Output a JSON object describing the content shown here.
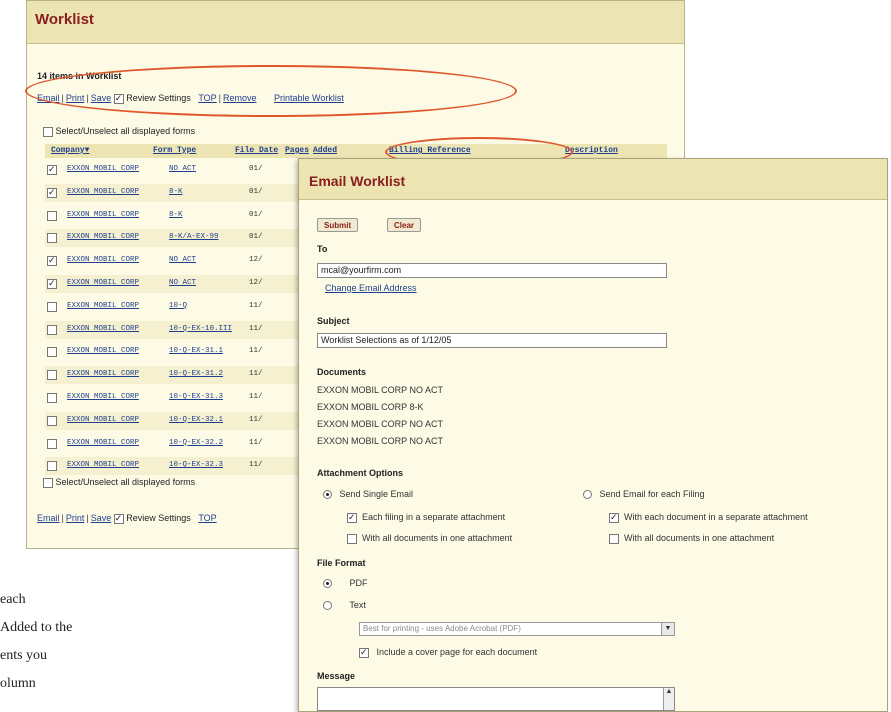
{
  "worklist": {
    "title": "Worklist",
    "count_text": "14 items in Worklist",
    "toolbar": {
      "email": "Email",
      "print": "Print",
      "save": "Save",
      "review_settings": "Review Settings",
      "top": "TOP",
      "remove": "Remove",
      "printable": "Printable Worklist"
    },
    "select_all": "Select/Unselect all displayed forms",
    "columns": [
      "Company",
      "Form Type",
      "File Date",
      "Pages",
      "Added",
      "Billing Reference",
      "Description"
    ],
    "rows": [
      {
        "company": "EXXON MOBIL CORP",
        "form": "NO ACT",
        "date": "01/",
        "checked": true
      },
      {
        "company": "EXXON MOBIL CORP",
        "form": "8-K",
        "date": "01/",
        "checked": true
      },
      {
        "company": "EXXON MOBIL CORP",
        "form": "8-K",
        "date": "01/",
        "checked": false
      },
      {
        "company": "EXXON MOBIL CORP",
        "form": "8-K/A-EX-99",
        "date": "01/",
        "checked": false
      },
      {
        "company": "EXXON MOBIL CORP",
        "form": "NO ACT",
        "date": "12/",
        "checked": true
      },
      {
        "company": "EXXON MOBIL CORP",
        "form": "NO ACT",
        "date": "12/",
        "checked": true
      },
      {
        "company": "EXXON MOBIL CORP",
        "form": "10-Q",
        "date": "11/",
        "checked": false
      },
      {
        "company": "EXXON MOBIL CORP",
        "form": "10-Q-EX-10.III",
        "date": "11/",
        "checked": false
      },
      {
        "company": "EXXON MOBIL CORP",
        "form": "10-Q-EX-31.1",
        "date": "11/",
        "checked": false
      },
      {
        "company": "EXXON MOBIL CORP",
        "form": "10-Q-EX-31.2",
        "date": "11/",
        "checked": false
      },
      {
        "company": "EXXON MOBIL CORP",
        "form": "10-Q-EX-31.3",
        "date": "11/",
        "checked": false
      },
      {
        "company": "EXXON MOBIL CORP",
        "form": "10-Q-EX-32.1",
        "date": "11/",
        "checked": false
      },
      {
        "company": "EXXON MOBIL CORP",
        "form": "10-Q-EX-32.2",
        "date": "11/",
        "checked": false
      },
      {
        "company": "EXXON MOBIL CORP",
        "form": "10-Q-EX-32.3",
        "date": "11/",
        "checked": false
      }
    ]
  },
  "email": {
    "title": "Email Worklist",
    "submit": "Submit",
    "clear": "Clear",
    "to_label": "To",
    "to_value": "mcal@yourfirm.com",
    "change_email": "Change Email Address",
    "subject_label": "Subject",
    "subject_value": "Worklist Selections as of 1/12/05",
    "documents_label": "Documents",
    "documents": [
      "EXXON MOBIL CORP NO ACT",
      "EXXON MOBIL CORP 8-K",
      "EXXON MOBIL CORP NO ACT",
      "EXXON MOBIL CORP NO ACT"
    ],
    "attachment_label": "Attachment Options",
    "send_single": "Send Single Email",
    "send_each": "Send Email for each Filing",
    "each_filing_separate": "Each filing in a separate attachment",
    "all_docs_one": "With all documents in one attachment",
    "each_doc_separate": "With each document in a separate attachment",
    "all_docs_one_right": "With all documents in one attachment",
    "file_format_label": "File Format",
    "pdf": "PDF",
    "text": "Text",
    "printing_select": "Best for printing - uses Adobe Acrobat (PDF)",
    "cover_page": "Include a cover page for each document",
    "message_label": "Message"
  },
  "side_text": [
    "each",
    "Added to the",
    "ents you",
    "olumn"
  ]
}
